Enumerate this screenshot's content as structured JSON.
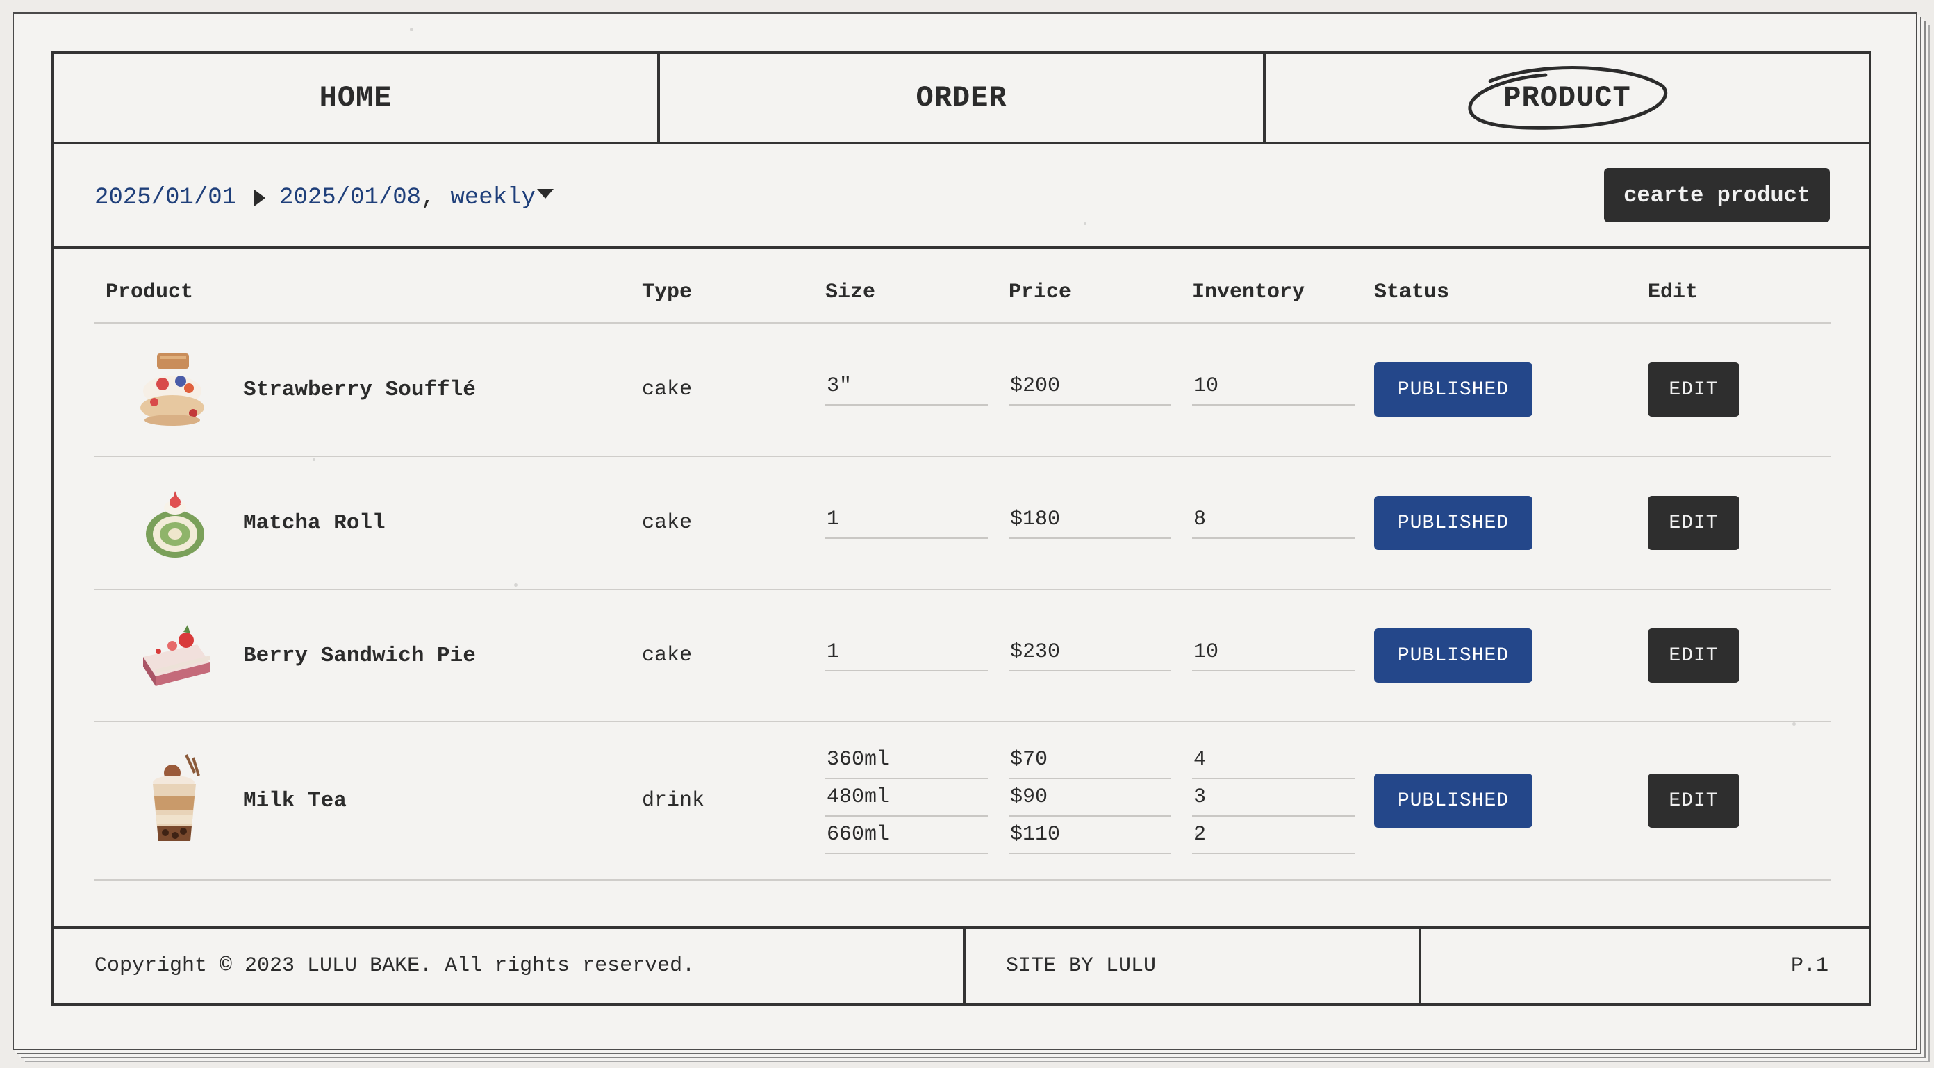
{
  "nav": {
    "items": [
      {
        "label": "HOME",
        "active": false
      },
      {
        "label": "ORDER",
        "active": false
      },
      {
        "label": "PRODUCT",
        "active": true
      }
    ]
  },
  "toolbar": {
    "start_date": "2025/01/01",
    "end_date": "2025/01/08",
    "separator": ",",
    "period": "weekly",
    "create_label": "cearte product"
  },
  "table": {
    "headers": [
      "Product",
      "Type",
      "Size",
      "Price",
      "Inventory",
      "Status",
      "Edit"
    ],
    "rows": [
      {
        "name": "Strawberry Soufflé",
        "type": "cake",
        "variants": [
          {
            "size": "3″",
            "price": "$200",
            "inventory": "10"
          }
        ],
        "status": "PUBLISHED",
        "edit": "EDIT",
        "thumb": "souffle-icon"
      },
      {
        "name": "Matcha Roll",
        "type": "cake",
        "variants": [
          {
            "size": "1",
            "price": "$180",
            "inventory": "8"
          }
        ],
        "status": "PUBLISHED",
        "edit": "EDIT",
        "thumb": "matcha-roll-icon"
      },
      {
        "name": "Berry Sandwich Pie",
        "type": "cake",
        "variants": [
          {
            "size": "1",
            "price": "$230",
            "inventory": "10"
          }
        ],
        "status": "PUBLISHED",
        "edit": "EDIT",
        "thumb": "berry-pie-icon"
      },
      {
        "name": "Milk Tea",
        "type": "drink",
        "variants": [
          {
            "size": "360ml",
            "price": "$70",
            "inventory": "4"
          },
          {
            "size": "480ml",
            "price": "$90",
            "inventory": "3"
          },
          {
            "size": "660ml",
            "price": "$110",
            "inventory": "2"
          }
        ],
        "status": "PUBLISHED",
        "edit": "EDIT",
        "thumb": "milk-tea-icon"
      }
    ]
  },
  "footer": {
    "copyright": "Copyright © 2023 LULU BAKE. All rights reserved.",
    "site": "SITE BY LULU",
    "page": "P.1"
  },
  "colors": {
    "accent_blue": "#24478a",
    "date_blue": "#1f3f7a",
    "dark": "#2e2e2e",
    "paper": "#f4f3f1"
  }
}
